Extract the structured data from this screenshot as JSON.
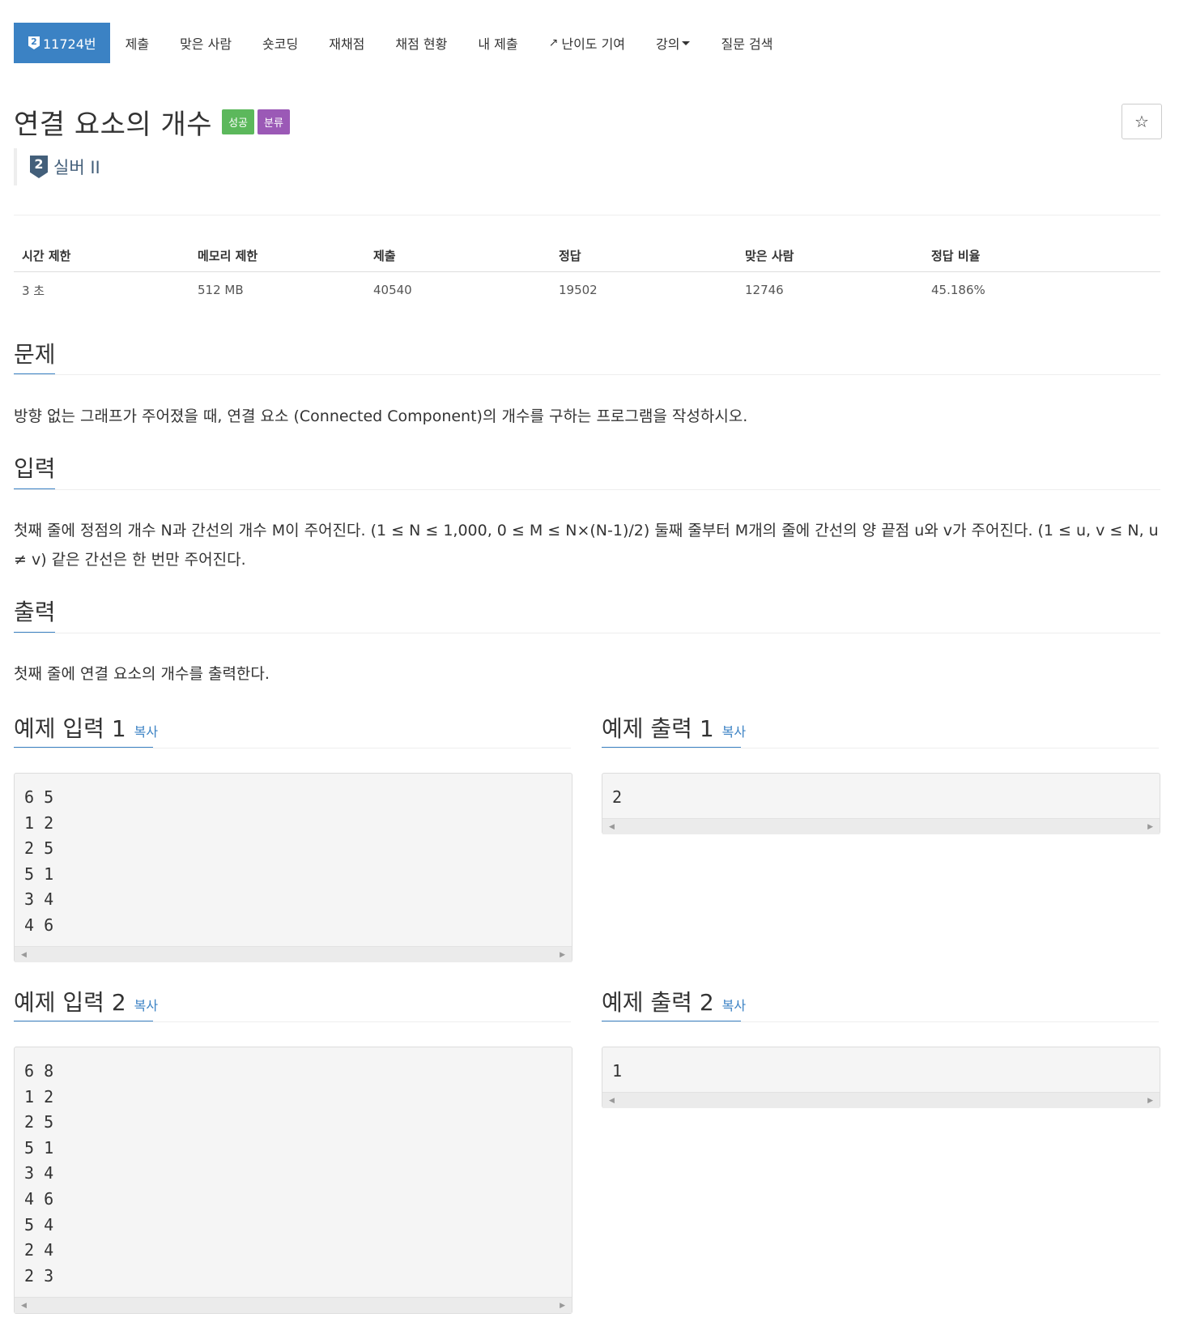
{
  "nav": {
    "active_tab_tier": "2",
    "active_tab": "11724번",
    "items": [
      "제출",
      "맞은 사람",
      "숏코딩",
      "재채점",
      "채점 현황",
      "내 제출",
      "난이도 기여",
      "강의",
      "질문 검색"
    ]
  },
  "title": "연결 요소의 개수",
  "badges": {
    "success": "성공",
    "category": "분류"
  },
  "tier": {
    "level": "2",
    "name": "실버 II"
  },
  "info": {
    "headers": [
      "시간 제한",
      "메모리 제한",
      "제출",
      "정답",
      "맞은 사람",
      "정답 비율"
    ],
    "values": [
      "3 초",
      "512 MB",
      "40540",
      "19502",
      "12746",
      "45.186%"
    ]
  },
  "problem": {
    "title": "문제",
    "text": "방향 없는 그래프가 주어졌을 때, 연결 요소 (Connected Component)의 개수를 구하는 프로그램을 작성하시오."
  },
  "input": {
    "title": "입력",
    "text": "첫째 줄에 정점의 개수 N과 간선의 개수 M이 주어진다. (1 ≤ N ≤ 1,000, 0 ≤ M ≤ N×(N-1)/2) 둘째 줄부터 M개의 줄에 간선의 양 끝점 u와 v가 주어진다. (1 ≤ u, v ≤ N, u ≠ v) 같은 간선은 한 번만 주어진다."
  },
  "output": {
    "title": "출력",
    "text": "첫째 줄에 연결 요소의 개수를 출력한다."
  },
  "samples": {
    "copy_label": "복사",
    "input1_title": "예제 입력 1",
    "output1_title": "예제 출력 1",
    "input2_title": "예제 입력 2",
    "output2_title": "예제 출력 2",
    "input1": "6 5\n1 2\n2 5\n5 1\n3 4\n4 6",
    "output1": "2",
    "input2": "6 8\n1 2\n2 5\n5 1\n3 4\n4 6\n5 4\n2 4\n2 3",
    "output2": "1"
  },
  "colors": {
    "primary": "#3b82c4",
    "success": "#5cb85c",
    "category": "#9b59b6",
    "tier_silver": "#435f7a"
  },
  "icons": {
    "star": "star-icon",
    "external": "external-link-icon",
    "caret": "caret-down-icon"
  }
}
